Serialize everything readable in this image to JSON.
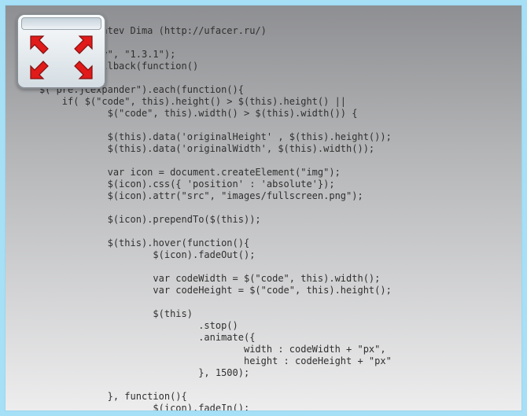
{
  "code_lines": [
    "",
    "             Zlatev Dima (http://ufacer.ru/)",
    "",
    "             ery\", \"1.3.1\");",
    "             Callback(function()",
    "{",
    "    $(\"pre.jcexpander\").each(function(){",
    "        if( $(\"code\", this).height() > $(this).height() ||",
    "                $(\"code\", this).width() > $(this).width()) {",
    "",
    "                $(this).data('originalHeight' , $(this).height());",
    "                $(this).data('originalWidth', $(this).width());",
    "",
    "                var icon = document.createElement(\"img\");",
    "                $(icon).css({ 'position' : 'absolute'});",
    "                $(icon).attr(\"src\", \"images/fullscreen.png\");",
    "",
    "                $(icon).prependTo($(this));",
    "",
    "                $(this).hover(function(){",
    "                        $(icon).fadeOut();",
    "",
    "                        var codeWidth = $(\"code\", this).width();",
    "                        var codeHeight = $(\"code\", this).height();",
    "",
    "                        $(this)",
    "                                .stop()",
    "                                .animate({",
    "                                        width : codeWidth + \"px\",",
    "                                        height : codeHeight + \"px\"",
    "                                }, 1500);",
    "",
    "                }, function(){",
    "                        $(icon).fadeIn();"
  ],
  "icon": {
    "name": "fullscreen-expand",
    "arrow_color": "#e11a1a",
    "arrow_stroke": "#801010"
  }
}
